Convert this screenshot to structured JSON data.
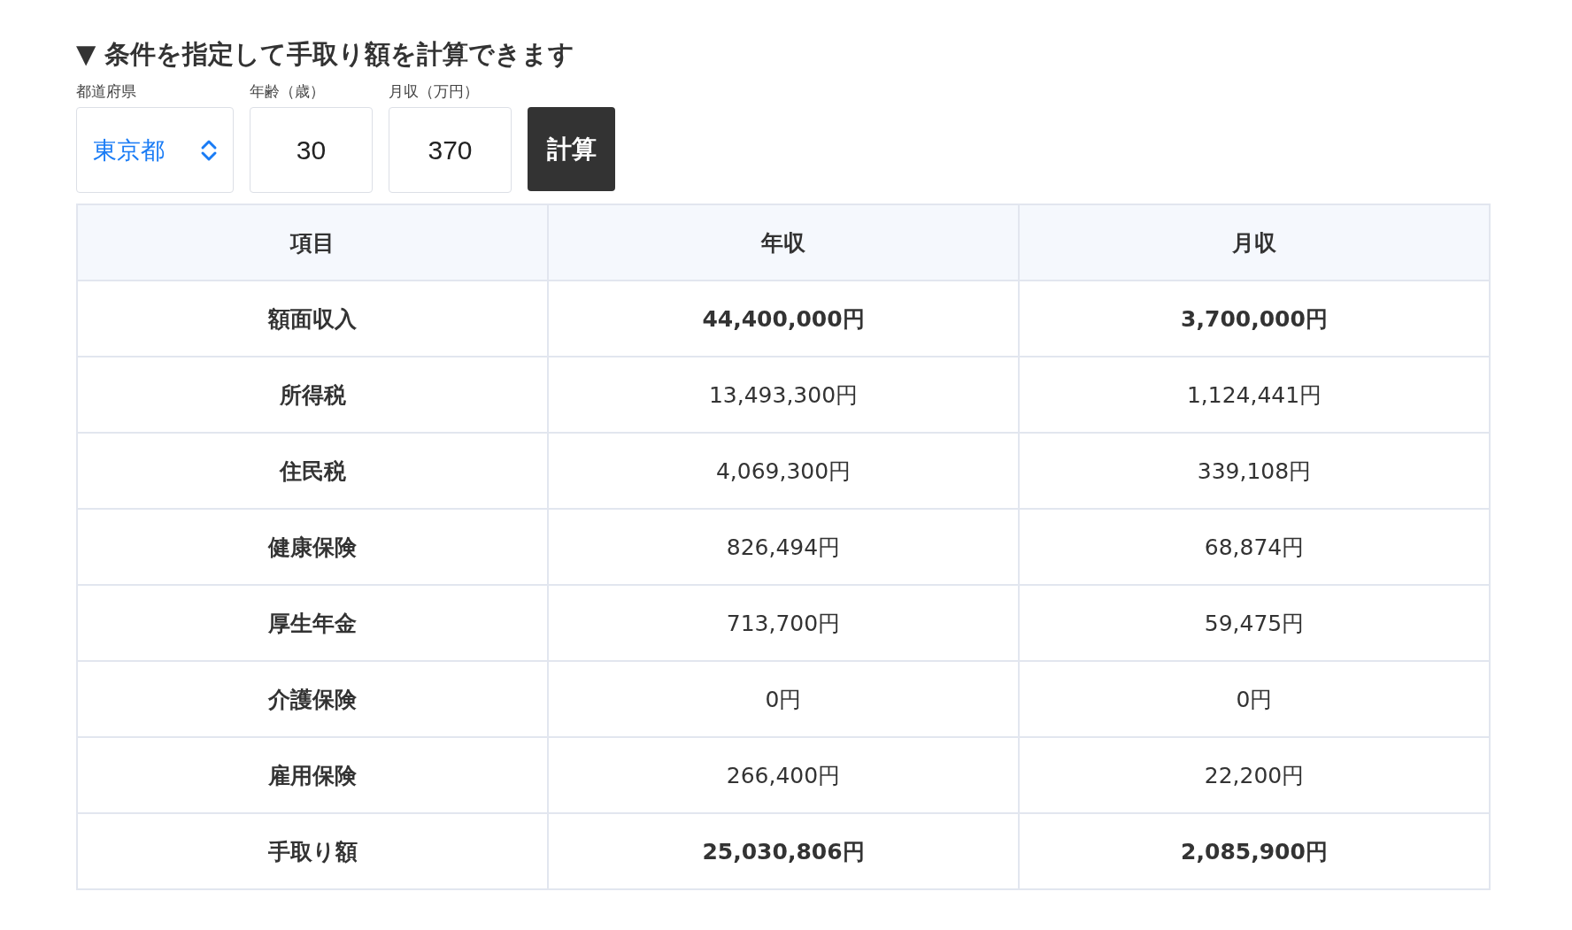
{
  "title": "▼ 条件を指定して手取り額を計算できます",
  "form": {
    "prefecture": {
      "label": "都道府県",
      "value": "東京都"
    },
    "age": {
      "label": "年齢（歳）",
      "value": "30"
    },
    "income": {
      "label": "月収（万円）",
      "value": "370"
    },
    "button": "計算"
  },
  "table": {
    "columns": [
      "項目",
      "年収",
      "月収"
    ],
    "rows": [
      {
        "cells": [
          "額面収入",
          "44,400,000円",
          "3,700,000円"
        ],
        "bold": true
      },
      {
        "cells": [
          "所得税",
          "13,493,300円",
          "1,124,441円"
        ],
        "bold": false
      },
      {
        "cells": [
          "住民税",
          "4,069,300円",
          "339,108円"
        ],
        "bold": false
      },
      {
        "cells": [
          "健康保険",
          "826,494円",
          "68,874円"
        ],
        "bold": false
      },
      {
        "cells": [
          "厚生年金",
          "713,700円",
          "59,475円"
        ],
        "bold": false
      },
      {
        "cells": [
          "介護保険",
          "0円",
          "0円"
        ],
        "bold": false
      },
      {
        "cells": [
          "雇用保険",
          "266,400円",
          "22,200円"
        ],
        "bold": false
      },
      {
        "cells": [
          "手取り額",
          "25,030,806円",
          "2,085,900円"
        ],
        "bold": true
      }
    ]
  }
}
